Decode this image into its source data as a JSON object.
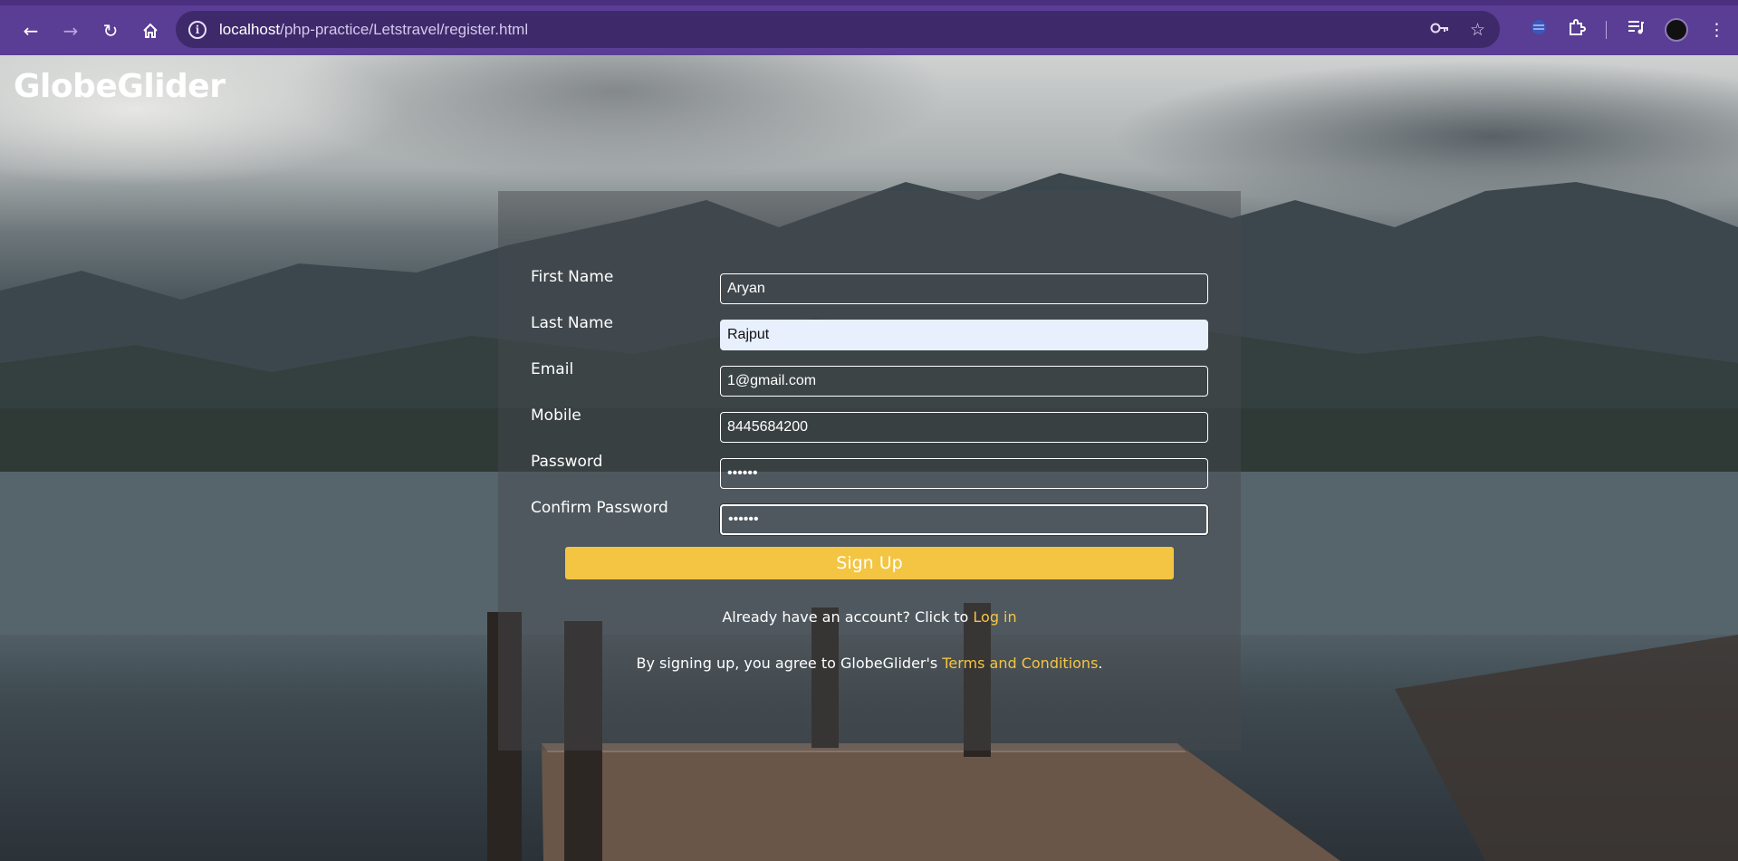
{
  "browser": {
    "url_host": "localhost",
    "url_path": "/php-practice/Letstravel/register.html",
    "icons": [
      "back-icon",
      "forward-icon",
      "reload-icon",
      "home-icon",
      "site-info-icon",
      "password-key-icon",
      "bookmark-star-icon",
      "extension-icon",
      "puzzle-extensions-icon",
      "media-queue-icon",
      "profile-avatar",
      "menu-kebab-icon"
    ]
  },
  "brand": {
    "name": "GlobeGlider"
  },
  "form": {
    "fields": [
      {
        "label": "First Name",
        "value": "Aryan"
      },
      {
        "label": "Last Name",
        "value": "Rajput"
      },
      {
        "label": "Email",
        "value": "1@gmail.com"
      },
      {
        "label": "Mobile",
        "value": "8445684200"
      },
      {
        "label": "Password",
        "value": "••••••"
      },
      {
        "label": "Confirm Password",
        "value": "••••••"
      }
    ],
    "submit_label": "Sign Up",
    "login_prompt": "Already have an account? Click to ",
    "login_link": "Log in",
    "terms_prompt": "By signing up, you agree to GlobeGlider's ",
    "terms_link": "Terms and Conditions",
    "terms_suffix": "."
  },
  "colors": {
    "accent": "#f4c542",
    "chrome": "#5a3d94",
    "omnibox": "#3e2a6b"
  }
}
